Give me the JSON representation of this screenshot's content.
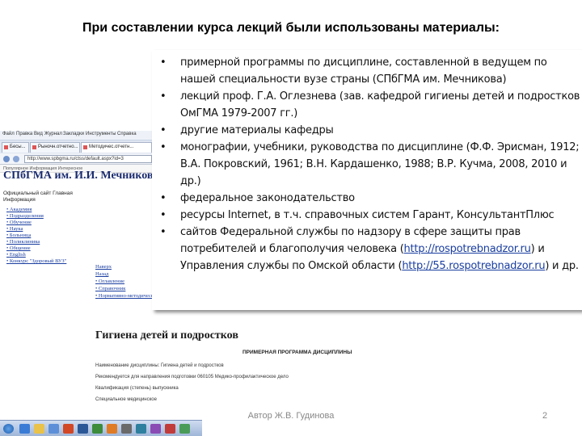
{
  "slide": {
    "title": "При составлении курса лекций были использованы материалы:",
    "author": "Автор Ж.В. Гудинова",
    "page_number": "2",
    "bullets": [
      {
        "text": "примерной программы по дисциплине, составленной в ведущем по нашей специальности вузе страны (СПбГМА им. Мечникова)"
      },
      {
        "text": "лекций проф. Г.А. Оглезнева (зав. кафедрой гигиены детей и подростков ОмГМА 1979-2007 гг.)"
      },
      {
        "text": "другие материалы кафедры"
      },
      {
        "text": "монографии, учебники, руководства по дисциплине (Ф.Ф. Эрисман, 1912; В.А. Покровский, 1961; В.Н. Кардашенко, 1988; В.Р. Кучма, 2008, 2010 и др.)"
      },
      {
        "text": "федеральное законодательство"
      },
      {
        "text": "ресурсы Internet, в т.ч. справочных систем Гарант, КонсультантПлюс"
      },
      {
        "text_before": "сайтов Федеральной службы по надзору в сфере защиты прав потребителей и благополучия человека (",
        "link1": "http://rospotrebnadzor.ru",
        "text_middle": ") и Управления службы по Омской области (",
        "link2": "http://55.rospotrebnadzor.ru",
        "text_after": ") и др."
      }
    ]
  },
  "browser": {
    "menu": [
      "Файл",
      "Правка",
      "Вид",
      "Журнал",
      "Закладки",
      "Инструменты",
      "Справка"
    ],
    "tabs": [
      {
        "label": "Бесы..."
      },
      {
        "label": "Рыночн.отчетно..."
      },
      {
        "label": "Методичес.отчетн..."
      }
    ],
    "url": "http://www.spbgma.ru/ctss/default.aspx?id=3",
    "bookmarks": "Популярное  Информация  Интересное",
    "site_header": "СПбГМА им. И.И. Мечникова",
    "site_sub": "Официальный сайт        Главная",
    "site_sub2": "Информация",
    "nav": [
      "Академия",
      "Подразделения",
      "Обучение",
      "Наука",
      "Больница",
      "Поликлиника",
      "Общение",
      "English",
      "Конкурс \"Здоровый ВУЗ\""
    ],
    "side_links": [
      "Наверх",
      "Назад",
      "Оглавление",
      "Справочник",
      "Нормативно-методические материалы"
    ],
    "course_title": "Гигиена детей и подростков",
    "program_label": "ПРИМЕРНАЯ ПРОГРАММА ДИСЦИПЛИНЫ",
    "doc_lines": [
      "Наименование дисциплины: Гигиена детей и подростков",
      "Рекомендуется для направления подготовки 060105 Медико-профилактическое дело",
      "Квалификация (степень) выпускника",
      "Специальное медицинское"
    ]
  },
  "colors": {
    "link": "#1a3ea0",
    "site_header": "#1a2b6e",
    "footer": "#888888"
  }
}
